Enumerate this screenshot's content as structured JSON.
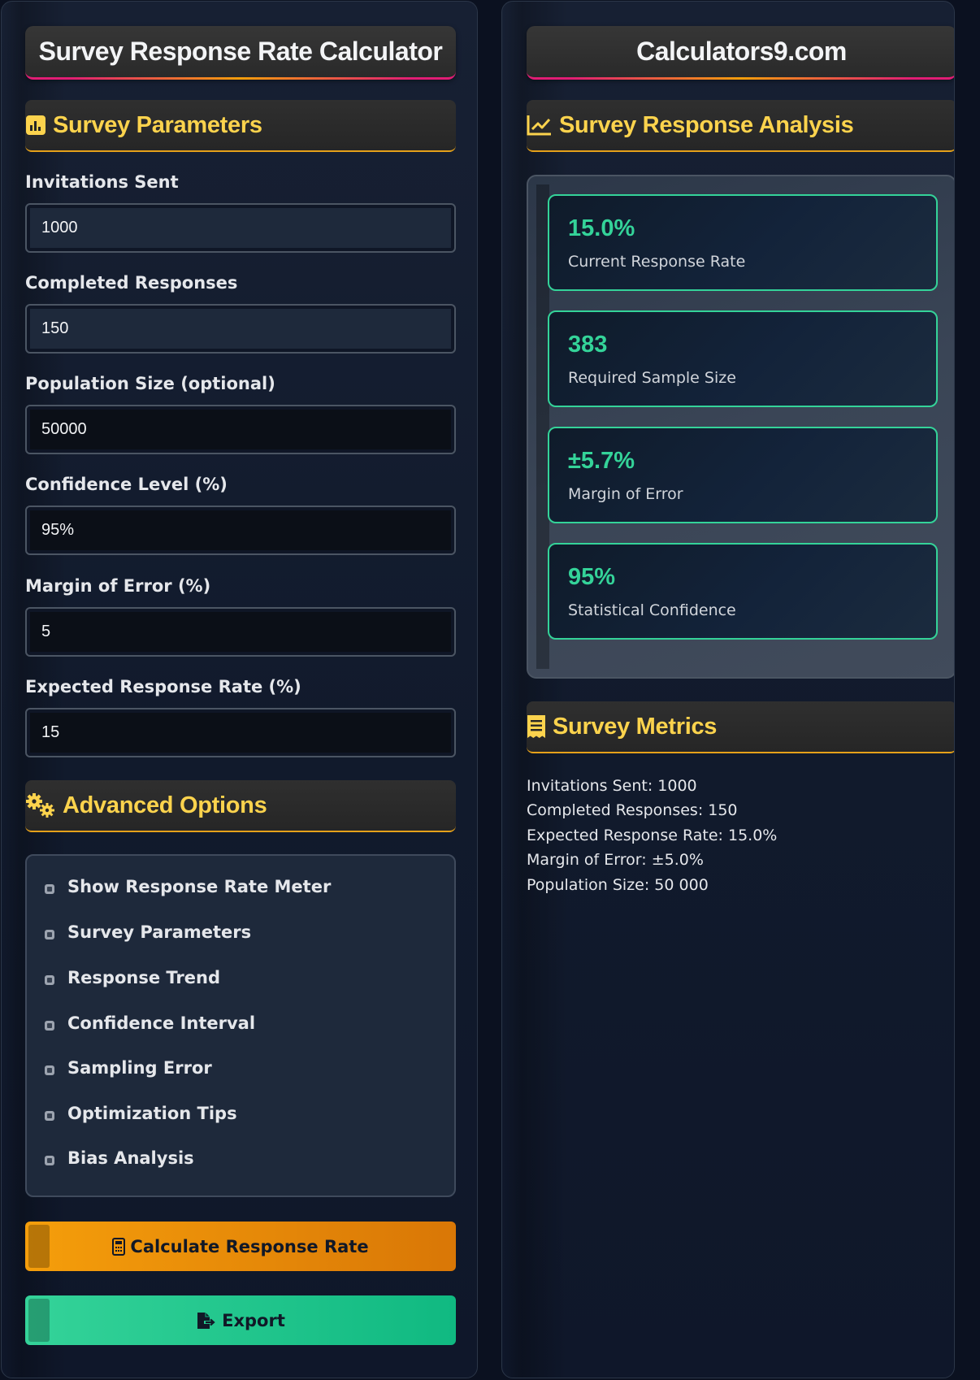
{
  "left": {
    "title": "Survey Response Rate Calculator",
    "params_heading": "Survey Parameters",
    "fields": [
      {
        "label": "Invitations Sent",
        "value": "1000"
      },
      {
        "label": "Completed Responses",
        "value": "150"
      },
      {
        "label": "Population Size (optional)",
        "value": "50000"
      },
      {
        "label": "Confidence Level (%)",
        "value": "95%"
      },
      {
        "label": "Margin of Error (%)",
        "value": "5"
      },
      {
        "label": "Expected Response Rate (%)",
        "value": "15"
      }
    ],
    "advanced_heading": "Advanced Options",
    "options": [
      "Show Response Rate Meter",
      "Survey Parameters",
      "Response Trend",
      "Confidence Interval",
      "Sampling Error",
      "Optimization Tips",
      "Bias Analysis"
    ],
    "calculate_label": "Calculate Response Rate",
    "export_label": "Export"
  },
  "right": {
    "title": "Calculators9.com",
    "analysis_heading": "Survey Response Analysis",
    "cards": [
      {
        "value": "15.0%",
        "caption": "Current Response Rate"
      },
      {
        "value": "383",
        "caption": "Required Sample Size"
      },
      {
        "value": "±5.7%",
        "caption": "Margin of Error"
      },
      {
        "value": "95%",
        "caption": "Statistical Confidence"
      }
    ],
    "metrics_heading": "Survey Metrics",
    "metrics": [
      "Invitations Sent: 1000",
      "Completed Responses: 150",
      "Expected Response Rate: 15.0%",
      "Margin of Error: ±5.0%",
      "Population Size: 50 000"
    ]
  },
  "colors": {
    "accent_yellow": "#fcd34d",
    "accent_green": "#34d399",
    "accent_orange": "#f59e0b",
    "accent_pink": "#e11d74"
  },
  "icons": {
    "params": "bar-chart-icon",
    "advanced": "gears-icon",
    "analysis": "line-chart-icon",
    "metrics": "receipt-icon",
    "calculate": "calculator-icon",
    "export": "file-export-icon"
  }
}
